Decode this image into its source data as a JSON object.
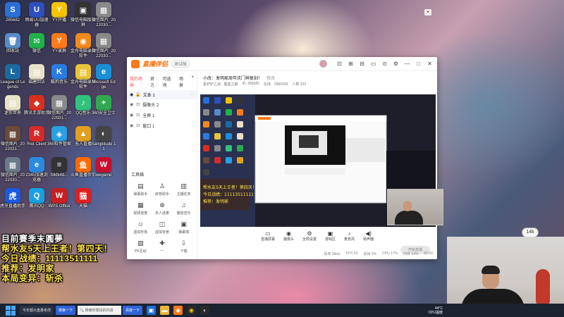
{
  "desktop": {
    "icons": [
      {
        "label": "285682",
        "color": "#2b6fd6",
        "glyph": "S"
      },
      {
        "label": "网易UU加速器",
        "color": "#2f4fbf",
        "glyph": "U"
      },
      {
        "label": "YY开播",
        "color": "#f5c400",
        "glyph": "Y"
      },
      {
        "label": "微信电脑版录屏",
        "color": "#333333",
        "glyph": "▣"
      },
      {
        "label": "微信图片_2022030...",
        "color": "#8a8a8a",
        "glyph": "▦"
      },
      {
        "label": "回收站",
        "color": "#5a8ac8",
        "glyph": "🗑"
      },
      {
        "label": "微信",
        "color": "#21b14a",
        "glyph": "✉"
      },
      {
        "label": "YY录屏",
        "color": "#ff7a1a",
        "glyph": "Y"
      },
      {
        "label": "金舟电脑录屏软件",
        "color": "#f08a1a",
        "glyph": "◉"
      },
      {
        "label": "微信图片_2022030...",
        "color": "#8a8a8a",
        "glyph": "▦"
      },
      {
        "label": "League of Legends",
        "color": "#1a6aa0",
        "glyph": "L"
      },
      {
        "label": "福建回访",
        "color": "#e8e2c8",
        "glyph": "▤"
      },
      {
        "label": "酷狗音乐",
        "color": "#2a7be0",
        "glyph": "K"
      },
      {
        "label": "金舟电脑录屏软件",
        "color": "#e7c43a",
        "glyph": "▤"
      },
      {
        "label": "Microsoft Edge",
        "color": "#1b8fd6",
        "glyph": "e"
      },
      {
        "label": "迷你世界",
        "color": "#e8e2c8",
        "glyph": "▤"
      },
      {
        "label": "腾讯手游助手",
        "color": "#d83020",
        "glyph": "◆"
      },
      {
        "label": "微信图片_2022031...",
        "color": "#8a8a8a",
        "glyph": "▦"
      },
      {
        "label": "QQ音乐",
        "color": "#31c27c",
        "glyph": "♪"
      },
      {
        "label": "360安全卫士",
        "color": "#2fa84f",
        "glyph": "+"
      },
      {
        "label": "微信图片_2022031...",
        "color": "#6a4a3a",
        "glyph": "▦"
      },
      {
        "label": "Riot Client",
        "color": "#d42a2a",
        "glyph": "R"
      },
      {
        "label": "360软件管家",
        "color": "#2aa0e0",
        "glyph": "◈"
      },
      {
        "label": "无人直播",
        "color": "#e0a020",
        "glyph": "▲"
      },
      {
        "label": "Samplitude 11",
        "color": "#444444",
        "glyph": "◐"
      },
      {
        "label": "微信图片_2022030...",
        "color": "#6a7a8a",
        "glyph": "▦"
      },
      {
        "label": "2345加速浏览器",
        "color": "#2a8ae0",
        "glyph": "e"
      },
      {
        "label": "fdkfk48...",
        "color": "#333333",
        "glyph": "≡"
      },
      {
        "label": "斗鱼直播伴侣",
        "color": "#ff6a00",
        "glyph": "鱼"
      },
      {
        "label": "wegame",
        "color": "#c8102e",
        "glyph": "W"
      },
      {
        "label": "虎牙直播助手",
        "color": "#1a5ae0",
        "glyph": "虎"
      },
      {
        "label": "腾讯QQ",
        "color": "#1aa0e0",
        "glyph": "Q"
      },
      {
        "label": "WPS Office",
        "color": "#c82020",
        "glyph": "W"
      },
      {
        "label": "天猫",
        "color": "#e02020",
        "glyph": "猫"
      }
    ]
  },
  "overlay": {
    "line1": "目前賽季末圓夢",
    "line2": "帮水友5天上王者！第四天！",
    "line3": "今日战绩：11113511111",
    "line4": "推荐：发明家",
    "line5": "本局变异：斩杀"
  },
  "window": {
    "app_name": "直播伴侣",
    "version": "测试版",
    "controls": [
      "⊡",
      "⊞",
      "⊟",
      "▭",
      "⊙",
      "⚙",
      "—",
      "□",
      "✕"
    ],
    "tabs": [
      {
        "label": "我的场景",
        "active": true
      },
      {
        "label": "官方",
        "active": false
      },
      {
        "label": "可选场",
        "active": false
      },
      {
        "label": "场景",
        "active": false
      }
    ],
    "scene_name": "文本 1",
    "layers": [
      {
        "label": "摄像头 2"
      },
      {
        "label": "全屏 1"
      },
      {
        "label": "窗口 1"
      }
    ],
    "tools_header": "工具箱",
    "tools": [
      {
        "label": "弹幕助手",
        "icon": "▤"
      },
      {
        "label": "房管助手",
        "icon": "♙"
      },
      {
        "label": "主播任务",
        "icon": "▥"
      },
      {
        "label": "视频连麦",
        "icon": "▦"
      },
      {
        "label": "多人连麦",
        "icon": "⊕"
      },
      {
        "label": "播放音乐",
        "icon": "♫"
      },
      {
        "label": "虚拟形象",
        "icon": "☺"
      },
      {
        "label": "虚拟背景",
        "icon": "◫"
      },
      {
        "label": "弹幕墙",
        "icon": "▣"
      },
      {
        "label": "PK互动",
        "icon": "▧"
      },
      {
        "label": "—",
        "icon": "✚"
      },
      {
        "label": "下载",
        "icon": "⇩"
      }
    ],
    "room_title": "小改：发明家周年庆门神复刻！",
    "room_title_edit": "修改",
    "room_info": [
      "金铲铲之战 · 图鉴之巅",
      "ID: 285682",
      "在线：2856303",
      "人数 232"
    ],
    "live_bar": [
      {
        "label": "直播屏幕",
        "icon": "▭"
      },
      {
        "label": "摄像头",
        "icon": "◉"
      },
      {
        "label": "全局设置",
        "icon": "⚙"
      },
      {
        "label": "游戏区",
        "icon": "▣"
      },
      {
        "label": "麦克风",
        "icon": "♪"
      },
      {
        "label": "扬声器",
        "icon": "◀)"
      }
    ],
    "start_button": "开始直播",
    "status": [
      "码率 0kb/s",
      "FPS 60",
      "丢帧 0%",
      "CPU 17%",
      "内存 14%",
      "60:00"
    ]
  },
  "taskbar": {
    "pill_text": "今年都大盘量考虑",
    "search_button": "搜索一下",
    "search_text": "搜索你想找的内容",
    "baidu": "百度一下",
    "tray_temp": "44°C",
    "tray_label": "CPU温度"
  },
  "cam_badge": "14k"
}
